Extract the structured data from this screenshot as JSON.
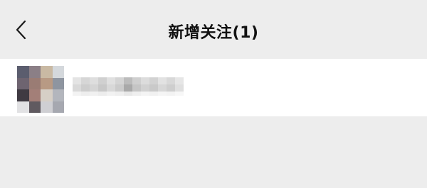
{
  "nav": {
    "title": "新增关注(1)",
    "back_icon": "chevron-left-icon"
  },
  "new_followers": {
    "count": 1,
    "items": [
      {
        "avatar_icon": "blurred-avatar",
        "name": ""
      }
    ]
  },
  "colors": {
    "background": "#ededed",
    "row_background": "#ffffff",
    "title_text": "#111111",
    "icon": "#1a1a1a"
  }
}
